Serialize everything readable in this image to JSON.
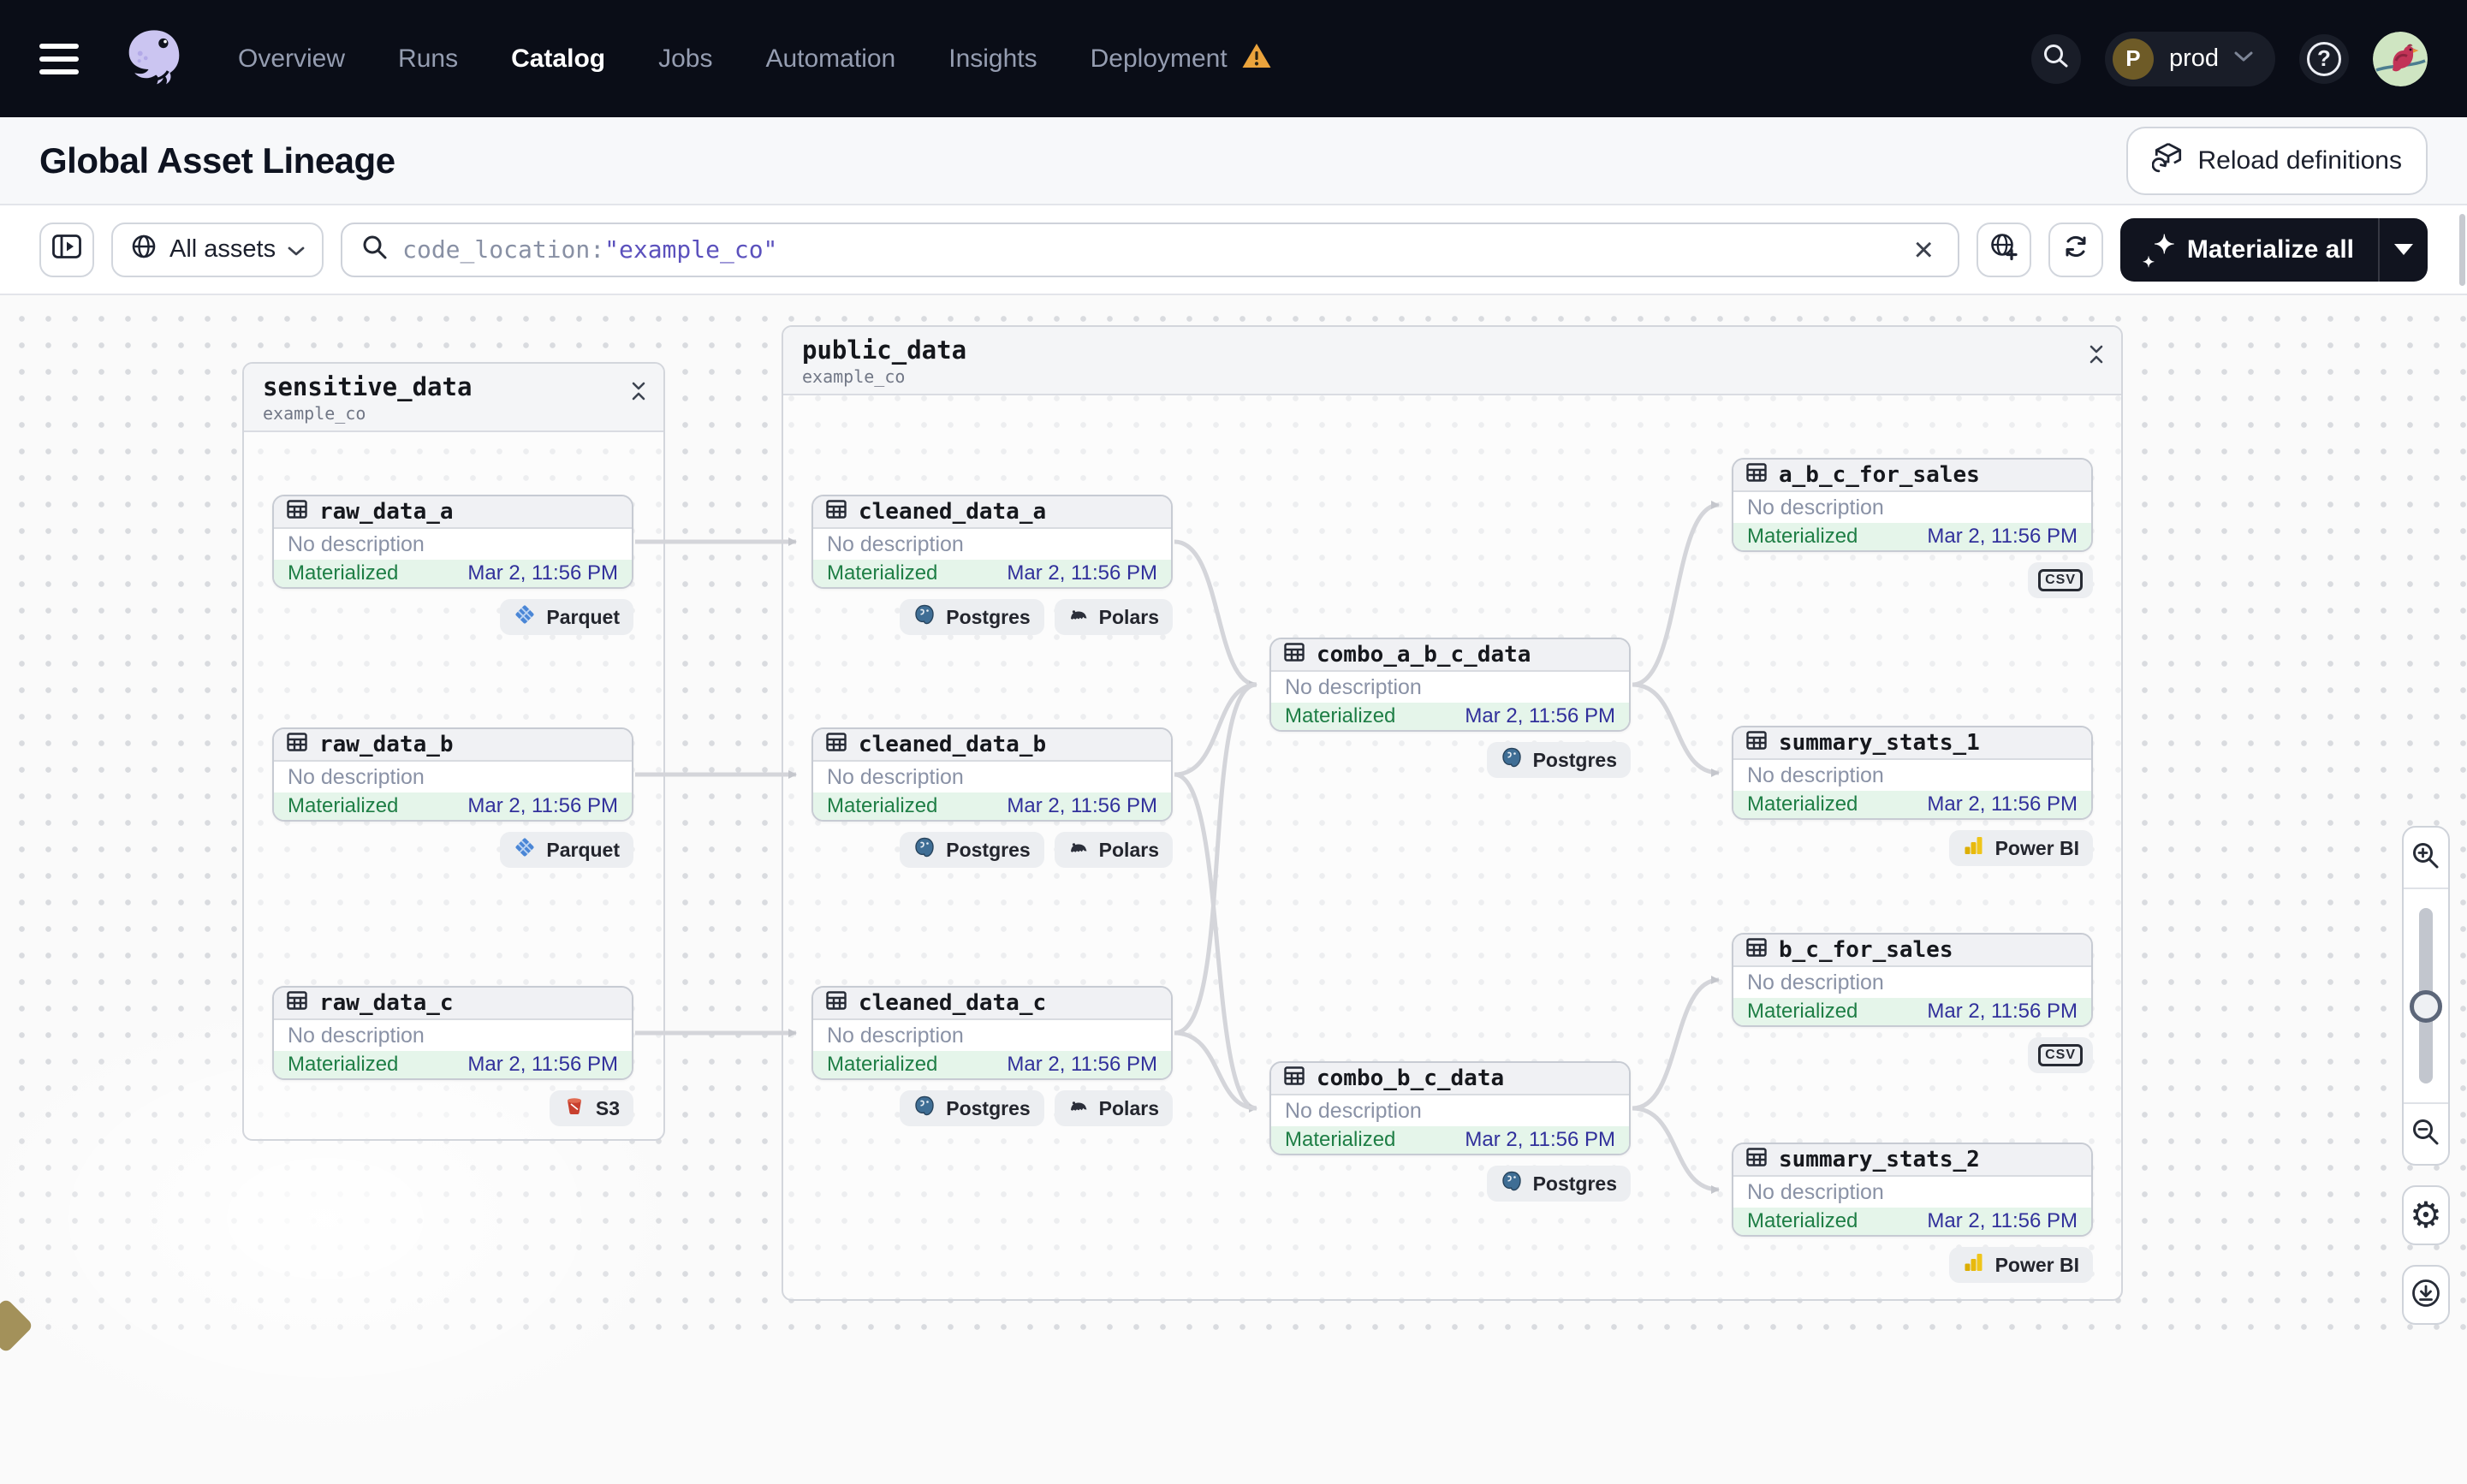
{
  "colors": {
    "nav_bg": "#0a0d17",
    "accent_purple": "#5b51bd",
    "materialized_green": "#1e7e45",
    "timestamp_navy": "#31309b",
    "warning_orange": "#eba33c"
  },
  "nav": {
    "items": [
      {
        "label": "Overview"
      },
      {
        "label": "Runs"
      },
      {
        "label": "Catalog"
      },
      {
        "label": "Jobs"
      },
      {
        "label": "Automation"
      },
      {
        "label": "Insights"
      },
      {
        "label": "Deployment"
      }
    ],
    "environment": {
      "initial": "P",
      "label": "prod"
    },
    "help_label": "?"
  },
  "header": {
    "title": "Global Asset Lineage",
    "reload_button": "Reload definitions"
  },
  "toolbar": {
    "scope_button": "All assets",
    "search_prefix": "code_location:",
    "search_value": "\"example_co\"",
    "clear_label": "×",
    "materialize_button": "Materialize all"
  },
  "graph": {
    "groups": [
      {
        "name": "sensitive_data",
        "subtitle": "example_co",
        "nodes": [
          {
            "name": "raw_data_a",
            "description": "No description",
            "status": "Materialized",
            "timestamp": "Mar 2, 11:56 PM",
            "badges": [
              {
                "label": "Parquet"
              }
            ]
          },
          {
            "name": "raw_data_b",
            "description": "No description",
            "status": "Materialized",
            "timestamp": "Mar 2, 11:56 PM",
            "badges": [
              {
                "label": "Parquet"
              }
            ]
          },
          {
            "name": "raw_data_c",
            "description": "No description",
            "status": "Materialized",
            "timestamp": "Mar 2, 11:56 PM",
            "badges": [
              {
                "label": "S3"
              }
            ]
          }
        ]
      },
      {
        "name": "public_data",
        "subtitle": "example_co",
        "nodes": [
          {
            "name": "cleaned_data_a",
            "description": "No description",
            "status": "Materialized",
            "timestamp": "Mar 2, 11:56 PM",
            "badges": [
              {
                "label": "Postgres"
              },
              {
                "label": "Polars"
              }
            ]
          },
          {
            "name": "cleaned_data_b",
            "description": "No description",
            "status": "Materialized",
            "timestamp": "Mar 2, 11:56 PM",
            "badges": [
              {
                "label": "Postgres"
              },
              {
                "label": "Polars"
              }
            ]
          },
          {
            "name": "cleaned_data_c",
            "description": "No description",
            "status": "Materialized",
            "timestamp": "Mar 2, 11:56 PM",
            "badges": [
              {
                "label": "Postgres"
              },
              {
                "label": "Polars"
              }
            ]
          },
          {
            "name": "combo_a_b_c_data",
            "description": "No description",
            "status": "Materialized",
            "timestamp": "Mar 2, 11:56 PM",
            "badges": [
              {
                "label": "Postgres"
              }
            ]
          },
          {
            "name": "combo_b_c_data",
            "description": "No description",
            "status": "Materialized",
            "timestamp": "Mar 2, 11:56 PM",
            "badges": [
              {
                "label": "Postgres"
              }
            ]
          },
          {
            "name": "a_b_c_for_sales",
            "description": "No description",
            "status": "Materialized",
            "timestamp": "Mar 2, 11:56 PM",
            "badges": [
              {
                "label": "csv"
              }
            ]
          },
          {
            "name": "summary_stats_1",
            "description": "No description",
            "status": "Materialized",
            "timestamp": "Mar 2, 11:56 PM",
            "badges": [
              {
                "label": "Power BI"
              }
            ]
          },
          {
            "name": "b_c_for_sales",
            "description": "No description",
            "status": "Materialized",
            "timestamp": "Mar 2, 11:56 PM",
            "badges": [
              {
                "label": "csv"
              }
            ]
          },
          {
            "name": "summary_stats_2",
            "description": "No description",
            "status": "Materialized",
            "timestamp": "Mar 2, 11:56 PM",
            "badges": [
              {
                "label": "Power BI"
              }
            ]
          }
        ]
      }
    ]
  }
}
